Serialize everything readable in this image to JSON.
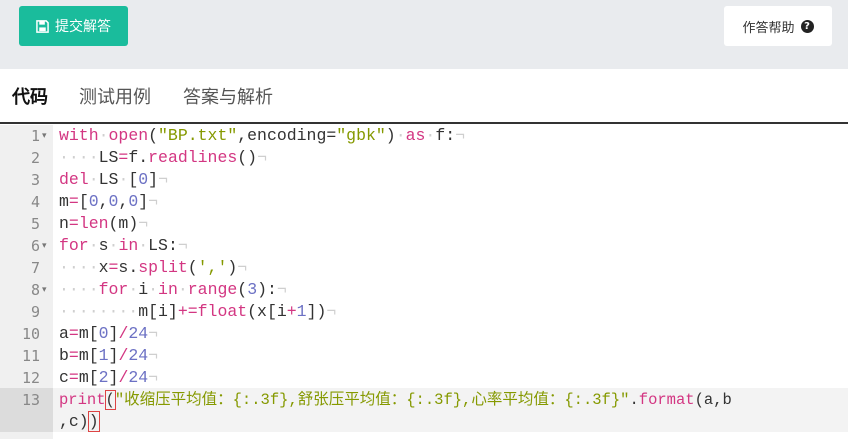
{
  "toolbar": {
    "submit_label": "提交解答",
    "help_label": "作答帮助"
  },
  "tabs": [
    {
      "label": "代码",
      "active": true
    },
    {
      "label": "测试用例",
      "active": false
    },
    {
      "label": "答案与解析",
      "active": false
    }
  ],
  "editor": {
    "line_numbers": [
      "1",
      "2",
      "3",
      "4",
      "5",
      "6",
      "7",
      "8",
      "9",
      "10",
      "11",
      "12",
      "13"
    ],
    "colors": {
      "keyword": "#d33682",
      "string": "#859900",
      "number": "#6c71c4"
    },
    "code": {
      "l1": {
        "t1": "with",
        "t2": "open",
        "t3": "(",
        "t4": "\"BP.txt\"",
        "t5": ",encoding=",
        "t6": "\"gbk\"",
        "t7": ")",
        "t8": "as",
        "t9": "f:"
      },
      "l2": {
        "t1": "LS",
        "t2": "=",
        "t3": "f.",
        "t4": "readlines",
        "t5": "()"
      },
      "l3": {
        "t1": "del",
        "t2": "LS",
        "t3": "[",
        "t4": "0",
        "t5": "]"
      },
      "l4": {
        "t1": "m",
        "t2": "=",
        "t3": "[",
        "t4": "0",
        "t5": ",",
        "t6": "0",
        "t7": ",",
        "t8": "0",
        "t9": "]"
      },
      "l5": {
        "t1": "n",
        "t2": "=",
        "t3": "len",
        "t4": "(m)"
      },
      "l6": {
        "t1": "for",
        "t2": "s",
        "t3": "in",
        "t4": "LS:"
      },
      "l7": {
        "t1": "x",
        "t2": "=",
        "t3": "s.",
        "t4": "split",
        "t5": "(",
        "t6": "','",
        "t7": ")"
      },
      "l8": {
        "t1": "for",
        "t2": "i",
        "t3": "in",
        "t4": "range",
        "t5": "(",
        "t6": "3",
        "t7": "):"
      },
      "l9": {
        "t1": "m[i]",
        "t2": "+=",
        "t3": "float",
        "t4": "(x[i",
        "t5": "+",
        "t6": "1",
        "t7": "])"
      },
      "l10": {
        "t1": "a",
        "t2": "=",
        "t3": "m[",
        "t4": "0",
        "t5": "]",
        "t6": "/",
        "t7": "24"
      },
      "l11": {
        "t1": "b",
        "t2": "=",
        "t3": "m[",
        "t4": "1",
        "t5": "]",
        "t6": "/",
        "t7": "24"
      },
      "l12": {
        "t1": "c",
        "t2": "=",
        "t3": "m[",
        "t4": "2",
        "t5": "]",
        "t6": "/",
        "t7": "24"
      },
      "l13": {
        "t1": "print",
        "t2": "(",
        "t3": "\"收缩压平均值：{:.3f},舒张压平均值：{:.3f},心率平均值：{:.3f}\"",
        "t4": ".",
        "t5": "format",
        "t6": "(a,b"
      },
      "l13b": {
        "t1": ",c)",
        "t2": ")"
      }
    }
  }
}
